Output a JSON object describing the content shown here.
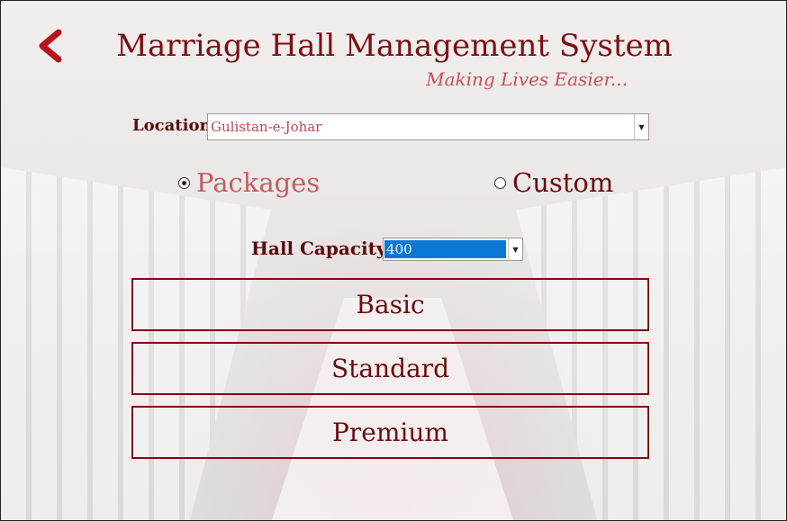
{
  "header": {
    "title": "Marriage Hall Management System",
    "subtitle": "Making Lives Easier..."
  },
  "location": {
    "label": "Location",
    "value": "Gulistan-e-Johar"
  },
  "mode": {
    "packages_label": "Packages",
    "custom_label": "Custom",
    "selected": "Packages"
  },
  "capacity": {
    "label": "Hall Capacity",
    "value": "400"
  },
  "packages": {
    "basic": "Basic",
    "standard": "Standard",
    "premium": "Premium"
  },
  "colors": {
    "accent": "#7a0f12",
    "subtitle": "#c54f55",
    "selection": "#0a78d7"
  },
  "icons": {
    "back": "back-arrow-icon",
    "dropdown": "chevron-down-icon"
  }
}
